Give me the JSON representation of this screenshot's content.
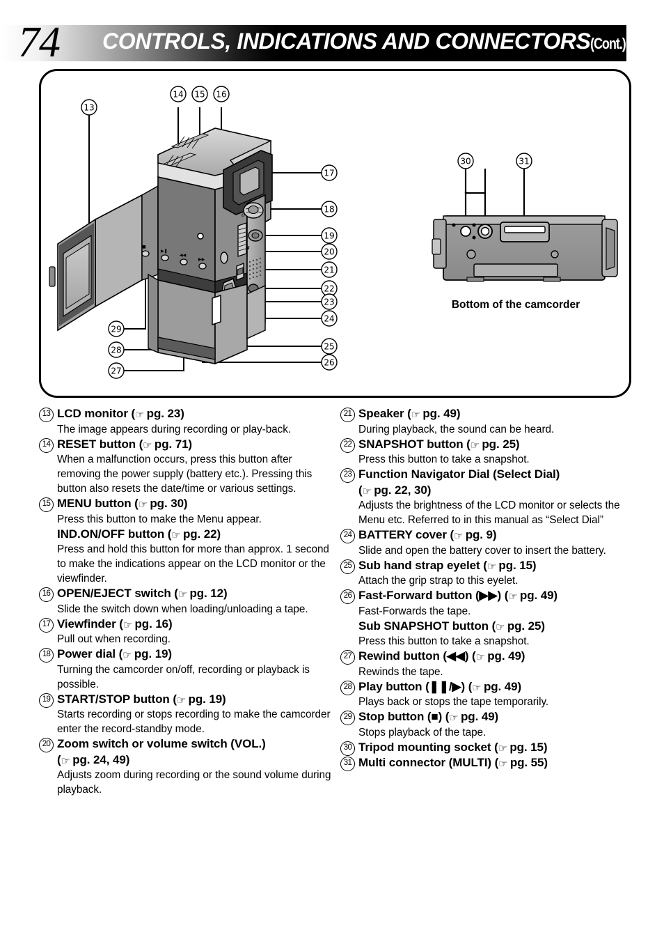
{
  "header": {
    "page_number": "74",
    "title": "CONTROLS, INDICATIONS AND CONNECTORS",
    "continued": "(Cont.)"
  },
  "figure": {
    "caption_bottom": "Bottom of the camcorder",
    "callouts_main": [
      "13",
      "14",
      "15",
      "16",
      "17",
      "18",
      "19",
      "20",
      "21",
      "22",
      "23",
      "24",
      "25",
      "26",
      "27",
      "28",
      "29"
    ],
    "callouts_bottom": [
      "30",
      "31"
    ]
  },
  "icons": {
    "hand": "☞",
    "fast_forward": "▶▶",
    "rewind": "◀◀",
    "play_pause": "❚❚/▶",
    "stop": "■"
  },
  "left_column": [
    {
      "num": "13",
      "title": "LCD monitor",
      "pg": "pg. 23",
      "desc": "The image appears during recording or play-back."
    },
    {
      "num": "14",
      "title": "RESET button",
      "pg": "pg. 71",
      "desc": "When a malfunction occurs, press this button after removing the power supply (battery etc.). Pressing this button also resets the date/time or various settings."
    },
    {
      "num": "15",
      "title": "MENU button",
      "pg": "pg. 30",
      "desc": "Press this button to make the Menu appear.",
      "sub_title": "IND.ON/OFF button",
      "sub_pg": "pg. 22",
      "sub_desc": "Press and hold this button for more than approx. 1 second to make the indications appear on the LCD monitor or the viewfinder."
    },
    {
      "num": "16",
      "title": "OPEN/EJECT switch",
      "pg": "pg. 12",
      "desc": "Slide the switch down when loading/unloading a tape."
    },
    {
      "num": "17",
      "title": "Viewfinder",
      "pg": "pg. 16",
      "desc": "Pull out when recording."
    },
    {
      "num": "18",
      "title": "Power dial",
      "pg": "pg. 19",
      "desc": "Turning the camcorder on/off, recording or playback is possible."
    },
    {
      "num": "19",
      "title": "START/STOP button",
      "pg": "pg. 19",
      "desc": "Starts recording or stops recording to make the camcorder enter the record-standby mode."
    },
    {
      "num": "20",
      "title": "Zoom switch or volume switch (VOL.)",
      "pg": "pg. 24, 49",
      "pg_on_new_line": true,
      "desc": "Adjusts zoom during recording or the sound volume during playback."
    }
  ],
  "right_column": [
    {
      "num": "21",
      "title": "Speaker",
      "pg": "pg. 49",
      "desc": "During playback, the sound can be heard."
    },
    {
      "num": "22",
      "title": "SNAPSHOT button",
      "pg": "pg. 25",
      "desc": "Press this button to take a snapshot."
    },
    {
      "num": "23",
      "title": "Function Navigator Dial (Select Dial)",
      "pg": "pg. 22, 30",
      "pg_on_new_line": true,
      "desc": "Adjusts the brightness of the LCD monitor or selects the Menu etc. Referred to in this manual as “Select Dial”"
    },
    {
      "num": "24",
      "title": "BATTERY cover",
      "pg": "pg. 9",
      "desc": "Slide and open the battery cover to insert the battery."
    },
    {
      "num": "25",
      "title": "Sub hand strap eyelet",
      "pg": "pg. 15",
      "desc": "Attach the grip strap to this eyelet."
    },
    {
      "num": "26",
      "title": "Fast-Forward button (▶▶)",
      "pg": "pg. 49",
      "desc": "Fast-Forwards the tape.",
      "sub_title": "Sub SNAPSHOT button",
      "sub_pg": "pg. 25",
      "sub_desc": "Press this button to take a snapshot."
    },
    {
      "num": "27",
      "title": "Rewind button (◀◀)",
      "pg": "pg. 49",
      "desc": "Rewinds the tape."
    },
    {
      "num": "28",
      "title": "Play button (❚❚/▶)",
      "pg": "pg. 49",
      "desc": "Plays back or stops the tape temporarily."
    },
    {
      "num": "29",
      "title": "Stop button (■)",
      "pg": "pg. 49",
      "desc": "Stops playback of the tape."
    },
    {
      "num": "30",
      "title": "Tripod mounting socket",
      "pg": "pg. 15",
      "desc": ""
    },
    {
      "num": "31",
      "title": "Multi connector (MULTI)",
      "pg": "pg. 55",
      "desc": ""
    }
  ]
}
